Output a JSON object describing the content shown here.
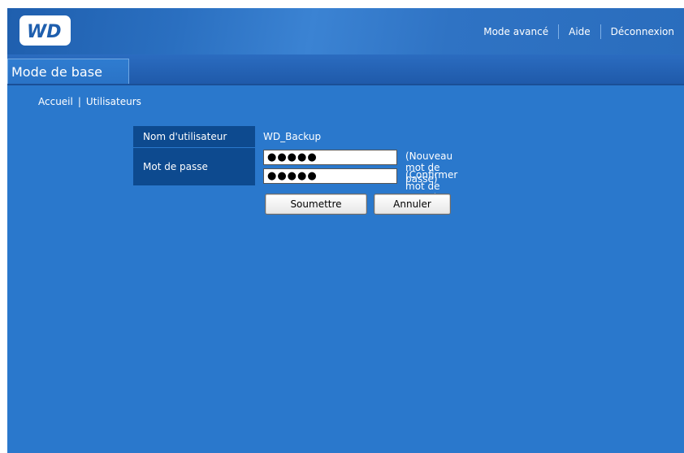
{
  "header": {
    "logo_text": "WD",
    "nav": [
      {
        "label": "Mode avancé"
      },
      {
        "label": "Aide"
      },
      {
        "label": "Déconnexion"
      }
    ]
  },
  "tab": {
    "active_label": "Mode de base"
  },
  "breadcrumb": {
    "items": [
      "Accueil",
      "Utilisateurs"
    ],
    "separator": "|"
  },
  "form": {
    "username_label": "Nom d'utilisateur",
    "username_value": "WD_Backup",
    "password_label": "Mot de passe",
    "password_masked": "●●●●●",
    "confirm_masked": "●●●●●",
    "new_password_hint": "(Nouveau mot de passe)",
    "confirm_password_hint": "(Confirmer mot de passe)",
    "submit_label": "Soumettre",
    "cancel_label": "Annuler"
  },
  "colors": {
    "background": "#2a78cc",
    "label_bg": "#0d4a8f",
    "header": "#1f5fae"
  }
}
